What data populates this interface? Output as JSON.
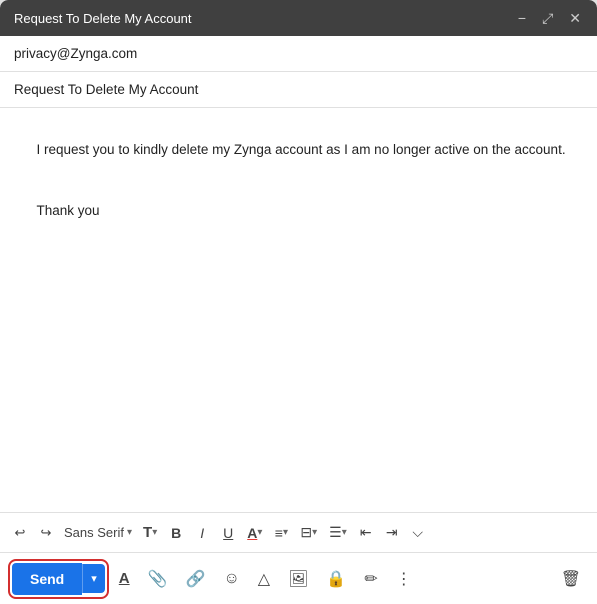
{
  "window": {
    "title": "Request To Delete My Account",
    "controls": {
      "minimize": "−",
      "expand": "⤢",
      "close": "✕"
    }
  },
  "compose": {
    "to": "privacy@Zynga.com",
    "subject": "Request To Delete My Account",
    "body_line1": "I request you to kindly delete my Zynga account as I am no longer active on the account.",
    "body_line2": "Thank you"
  },
  "toolbar": {
    "undo": "↩",
    "redo": "↪",
    "font_name": "Sans Serif",
    "text_style_label": "T",
    "bold_label": "B",
    "italic_label": "I",
    "underline_label": "U",
    "font_color_label": "A",
    "align_label": "≡",
    "numbered_list": "⋮",
    "bullet_list": "⋮",
    "indent_less": "⇤",
    "indent_more": "⇥",
    "more": "⌵"
  },
  "bottom_bar": {
    "send_label": "Send",
    "send_dropdown": "▾",
    "format_icon": "A",
    "attach_icon": "📎",
    "link_icon": "🔗",
    "emoji_icon": "☺",
    "drive_icon": "△",
    "image_icon": "🖼",
    "lock_icon": "🔒",
    "pen_icon": "✏",
    "more_icon": "⋮",
    "trash_icon": "🗑"
  }
}
